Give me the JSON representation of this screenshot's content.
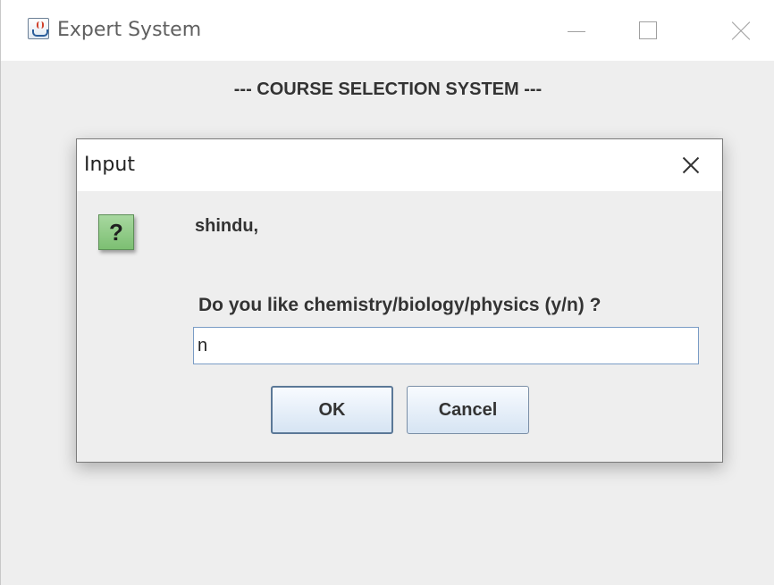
{
  "window": {
    "title": "Expert System",
    "header": "--- COURSE SELECTION SYSTEM ---"
  },
  "dialog": {
    "title": "Input",
    "icon": "question-icon",
    "name_line": "shindu,",
    "question": "Do you like chemistry/biology/physics (y/n) ?",
    "input_value": "n",
    "ok_label": "OK",
    "cancel_label": "Cancel"
  },
  "colors": {
    "icon_green": "#8cc982",
    "button_gradient_top": "#f8fbff",
    "button_gradient_bottom": "#d6e4f3",
    "input_border": "#7a9cc5"
  }
}
